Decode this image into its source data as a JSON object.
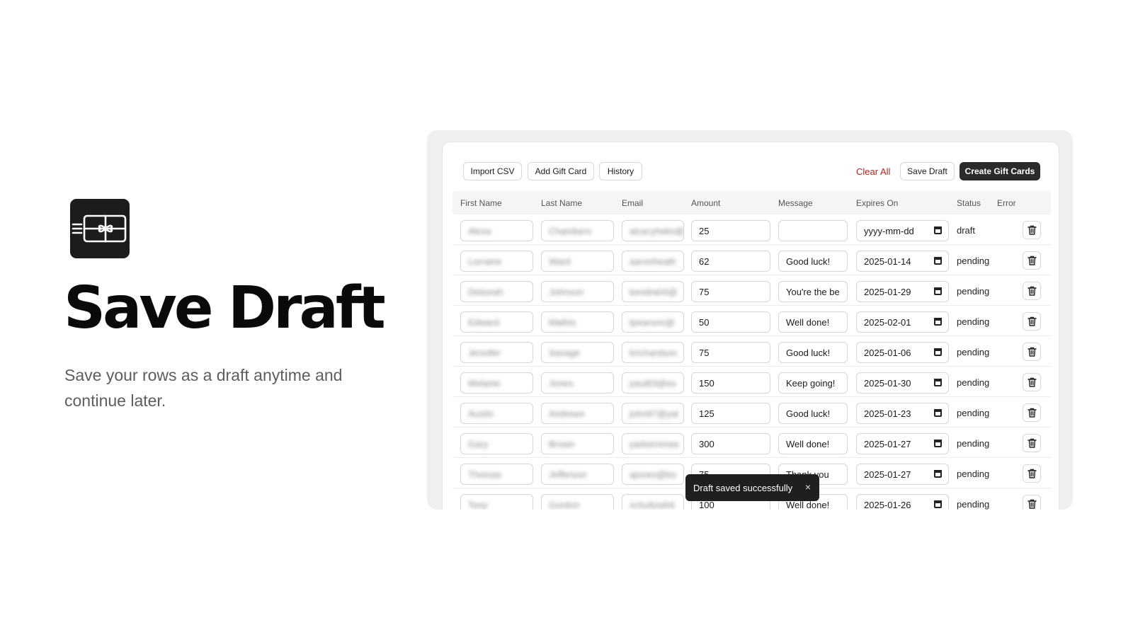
{
  "hero": {
    "icon": "gift-card-icon",
    "title": "Save Draft",
    "subtitle": "Save your rows as a draft anytime and continue later."
  },
  "toolbar": {
    "import_csv": "Import CSV",
    "add_gift_card": "Add Gift Card",
    "history": "History",
    "clear_all": "Clear All",
    "save_draft": "Save Draft",
    "create_gift_cards": "Create Gift Cards"
  },
  "table": {
    "headers": [
      "First Name",
      "Last Name",
      "Email",
      "Amount",
      "Message",
      "Expires On",
      "Status",
      "Error"
    ],
    "rows": [
      {
        "first_name": "Alexa",
        "last_name": "Chambers",
        "email": "aicacyheks@",
        "amount": "25",
        "message": "",
        "expires": "yyyy-mm-dd",
        "status": "draft"
      },
      {
        "first_name": "Lorraine",
        "last_name": "Ward",
        "email": "aaronheath",
        "amount": "62",
        "message": "Good luck!",
        "expires": "2025-01-14",
        "status": "pending"
      },
      {
        "first_name": "Deborah",
        "last_name": "Johnson",
        "email": "kendra04@",
        "amount": "75",
        "message": "You're the be",
        "expires": "2025-01-29",
        "status": "pending"
      },
      {
        "first_name": "Edward",
        "last_name": "Mathis",
        "email": "tpearson@",
        "amount": "50",
        "message": "Well done!",
        "expires": "2025-02-01",
        "status": "pending"
      },
      {
        "first_name": "Jennifer",
        "last_name": "Savage",
        "email": "krichardson",
        "amount": "75",
        "message": "Good luck!",
        "expires": "2025-01-06",
        "status": "pending"
      },
      {
        "first_name": "Melanie",
        "last_name": "Jones",
        "email": "paul63@ex",
        "amount": "150",
        "message": "Keep going!",
        "expires": "2025-01-30",
        "status": "pending"
      },
      {
        "first_name": "Austin",
        "last_name": "Andrews",
        "email": "john97@yal",
        "amount": "125",
        "message": "Good luck!",
        "expires": "2025-01-23",
        "status": "pending"
      },
      {
        "first_name": "Gary",
        "last_name": "Brown",
        "email": "parkerrenee",
        "amount": "300",
        "message": "Well done!",
        "expires": "2025-01-27",
        "status": "pending"
      },
      {
        "first_name": "Thomas",
        "last_name": "Jefferson",
        "email": "ajones@bo",
        "amount": "75",
        "message": "Thank you",
        "expires": "2025-01-27",
        "status": "pending"
      },
      {
        "first_name": "Tony",
        "last_name": "Gordon",
        "email": "schultzwhit",
        "amount": "100",
        "message": "Well done!",
        "expires": "2025-01-26",
        "status": "pending"
      }
    ]
  },
  "toast": {
    "message": "Draft saved successfully",
    "close": "×"
  },
  "colors": {
    "danger": "#b3261e",
    "dark": "#2b2b2b"
  }
}
